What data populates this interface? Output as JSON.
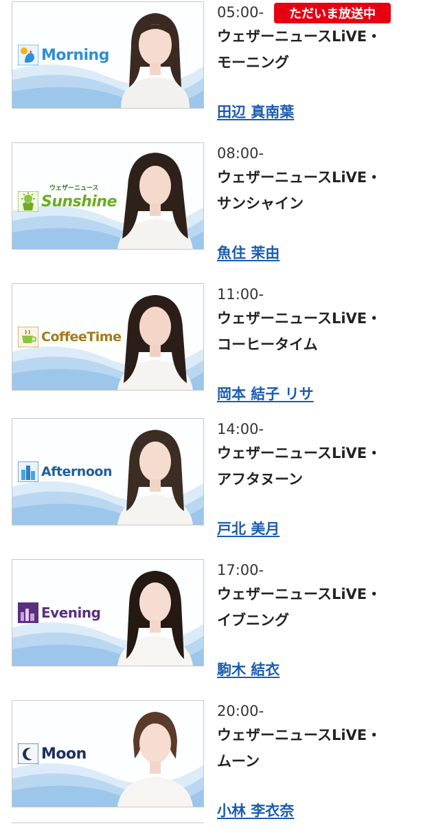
{
  "live_badge": "ただいま放送中",
  "programs": [
    {
      "time": "05:00-",
      "title_line1": "ウェザーニュースLiVE・",
      "title_line2": "モーニング",
      "caster": "田辺 真南葉",
      "logo_text": "Morning",
      "logo_color": "#2f8fd6",
      "icon": "rooster-icon"
    },
    {
      "time": "08:00-",
      "title_line1": "ウェザーニュースLiVE・",
      "title_line2": "サンシャイン",
      "caster": "魚住 茉由",
      "logo_text": "Sunshine",
      "logo_sub": "ウェザーニュース",
      "logo_color": "#6cac1f",
      "icon": "sun-shirt-icon"
    },
    {
      "time": "11:00-",
      "title_line1": "ウェザーニュースLiVE・",
      "title_line2": "コーヒータイム",
      "caster": "岡本 結子 リサ",
      "logo_text": "CoffeeTime",
      "logo_color": "#a77a1a",
      "icon": "coffee-cup-icon"
    },
    {
      "time": "14:00-",
      "title_line1": "ウェザーニュースLiVE・",
      "title_line2": "アフタヌーン",
      "caster": "戸北 美月",
      "logo_text": "Afternoon",
      "logo_color": "#1e5e9c",
      "icon": "city-buildings-icon"
    },
    {
      "time": "17:00-",
      "title_line1": "ウェザーニュースLiVE・",
      "title_line2": "イブニング",
      "caster": "駒木 結衣",
      "logo_text": "Evening",
      "logo_color": "#5a2f7e",
      "icon": "evening-city-icon"
    },
    {
      "time": "20:00-",
      "title_line1": "ウェザーニュースLiVE・",
      "title_line2": "ムーン",
      "caster": "小林 李衣奈",
      "logo_text": "Moon",
      "logo_color": "#1f2f5e",
      "icon": "crescent-moon-icon"
    }
  ]
}
